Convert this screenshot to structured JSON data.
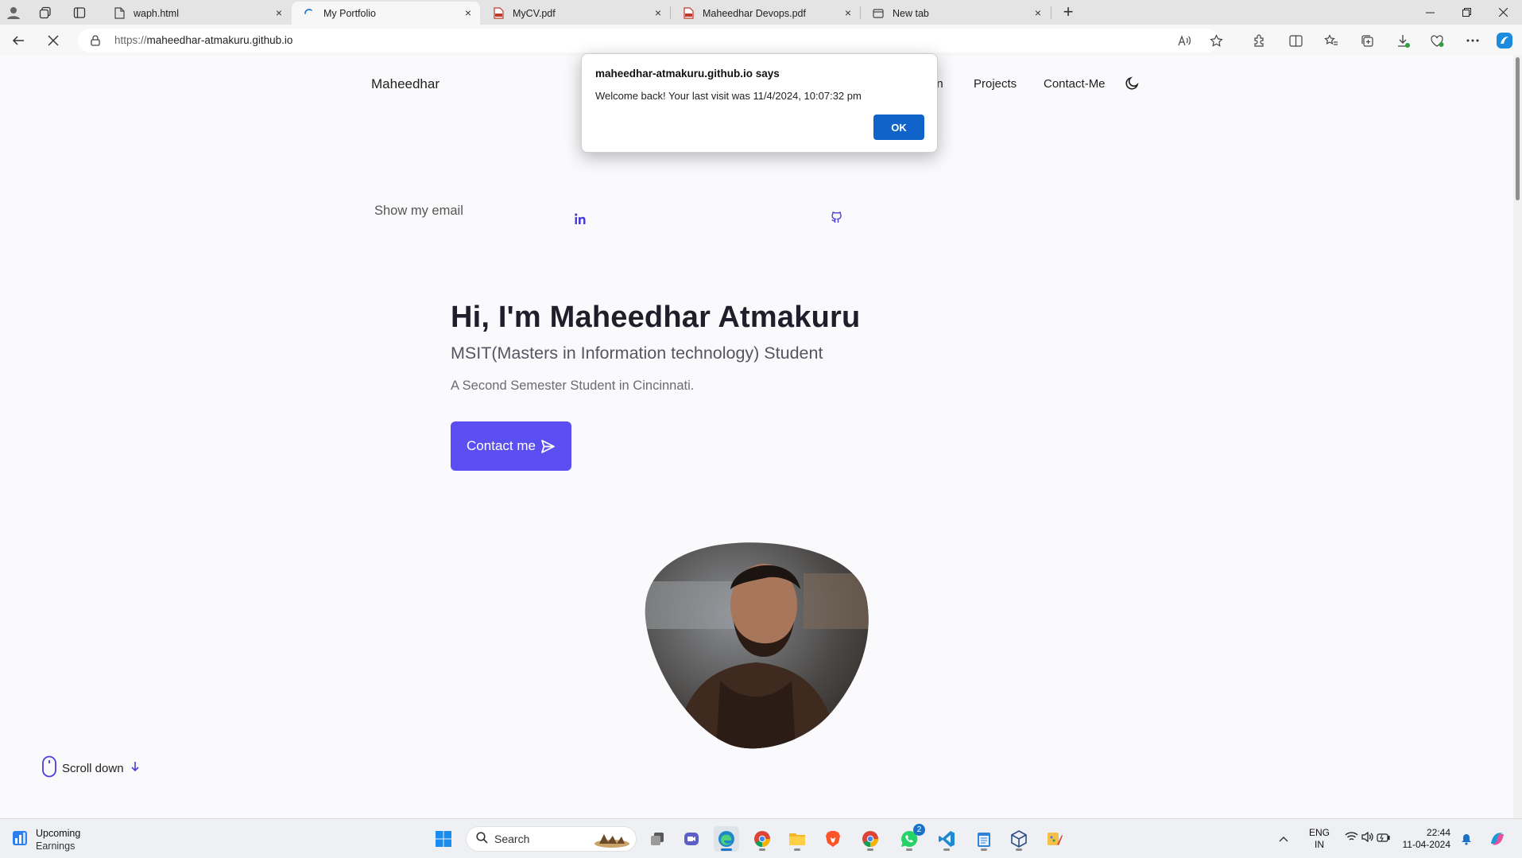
{
  "browser": {
    "tabs": [
      {
        "title": "waph.html",
        "icon": "document-icon",
        "active": false
      },
      {
        "title": "My Portfolio",
        "icon": "loading-spinner-icon",
        "active": true
      },
      {
        "title": "MyCV.pdf",
        "icon": "pdf-icon",
        "active": false
      },
      {
        "title": "Maheedhar Devops.pdf",
        "icon": "pdf-icon",
        "active": false
      },
      {
        "title": "New tab",
        "icon": "newtab-icon",
        "active": false
      }
    ],
    "url_scheme": "https://",
    "url_host": "maheedhar-atmakuru.github.io"
  },
  "dialog": {
    "title": "maheedhar-atmakuru.github.io says",
    "message": "Welcome back! Your last visit was 11/4/2024, 10:07:32 pm",
    "ok_label": "OK",
    "ok_color": "#0f63c9"
  },
  "site": {
    "brand": "Maheedhar",
    "nav": [
      {
        "label": "on"
      },
      {
        "label": "Projects"
      },
      {
        "label": "Contact-Me"
      }
    ],
    "show_email": "Show my email",
    "hero": {
      "title": "Hi, I'm Maheedhar Atmakuru",
      "subtitle": "MSIT(Masters in Information technology) Student",
      "description": "A Second Semester Student in Cincinnati.",
      "cta_label": "Contact me"
    },
    "scroll_label": "Scroll down",
    "accent": "#5b4ff1"
  },
  "taskbar": {
    "widget_line1": "Upcoming",
    "widget_line2": "Earnings",
    "search_label": "Search",
    "lang_line1": "ENG",
    "lang_line2": "IN",
    "time": "22:44",
    "date": "11-04-2024",
    "whatsapp_badge": "2"
  }
}
